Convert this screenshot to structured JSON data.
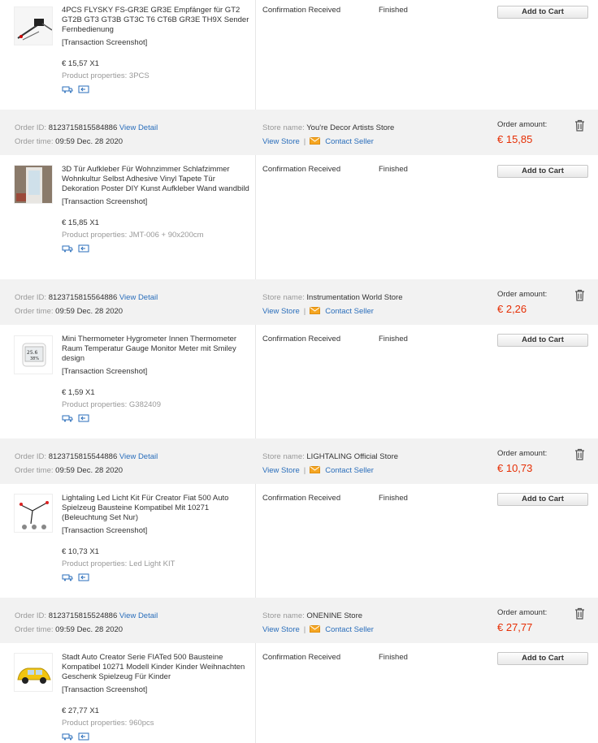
{
  "labels": {
    "order_id": "Order ID:",
    "view_detail": "View Detail",
    "order_time": "Order time:",
    "store_name": "Store name:",
    "view_store": "View Store",
    "contact_seller": "Contact Seller",
    "order_amount": "Order amount:",
    "transaction_screenshot": "[Transaction Screenshot]",
    "product_properties": "Product properties:",
    "add_to_cart": "Add to Cart"
  },
  "first_item": {
    "title": "4PCS FLYSKY FS-GR3E GR3E Empfänger für GT2 GT2B GT3 GT3B GT3C T6 CT6B GR3E TH9X Sender Fernbedienung",
    "price": "€ 15,57 X1",
    "properties": "3PCS",
    "status": "Confirmation Received",
    "finished": "Finished"
  },
  "orders": [
    {
      "order_id": "8123715815584886",
      "order_time": "09:59 Dec. 28 2020",
      "store": "You're Decor Artists Store",
      "amount": "€ 15,85",
      "item": {
        "title": "3D Tür Aufkleber Für Wohnzimmer Schlafzimmer Wohnkultur Selbst Adhesive Vinyl Tapete Tür Dekoration Poster DIY Kunst Aufkleber Wand wandbild",
        "price": "€ 15,85 X1",
        "properties": "JMT-006 + 90x200cm",
        "status": "Confirmation Received",
        "finished": "Finished"
      }
    },
    {
      "order_id": "8123715815564886",
      "order_time": "09:59 Dec. 28 2020",
      "store": "Instrumentation World Store",
      "amount": "€ 2,26",
      "item": {
        "title": "Mini Thermometer Hygrometer Innen Thermometer Raum Temperatur Gauge Monitor Meter mit Smiley design",
        "price": "€ 1,59 X1",
        "properties": "G382409",
        "status": "Confirmation Received",
        "finished": "Finished"
      }
    },
    {
      "order_id": "8123715815544886",
      "order_time": "09:59 Dec. 28 2020",
      "store": "LIGHTALING Official Store",
      "amount": "€ 10,73",
      "item": {
        "title": "Lightaling Led Licht Kit Für Creator Fiat 500 Auto Spielzeug Bausteine Kompatibel Mit 10271 (Beleuchtung Set Nur)",
        "price": "€ 10,73 X1",
        "properties": "Led Light KIT",
        "status": "Confirmation Received",
        "finished": "Finished"
      }
    },
    {
      "order_id": "8123715815524886",
      "order_time": "09:59 Dec. 28 2020",
      "store": "ONENINE Store",
      "amount": "€ 27,77",
      "item": {
        "title": "Stadt Auto Creator Serie FIATed 500 Bausteine Kompatibel 10271 Modell Kinder Kinder Weihnachten Geschenk Spielzeug Für Kinder",
        "price": "€ 27,77 X1",
        "properties": "960pcs",
        "status": "Confirmation Received",
        "finished": "Finished"
      }
    }
  ],
  "colors": {
    "link": "#2a6ebb",
    "amount": "#e62e04",
    "header_bg": "#f2f2f2",
    "mail_icon": "#f5a623"
  }
}
